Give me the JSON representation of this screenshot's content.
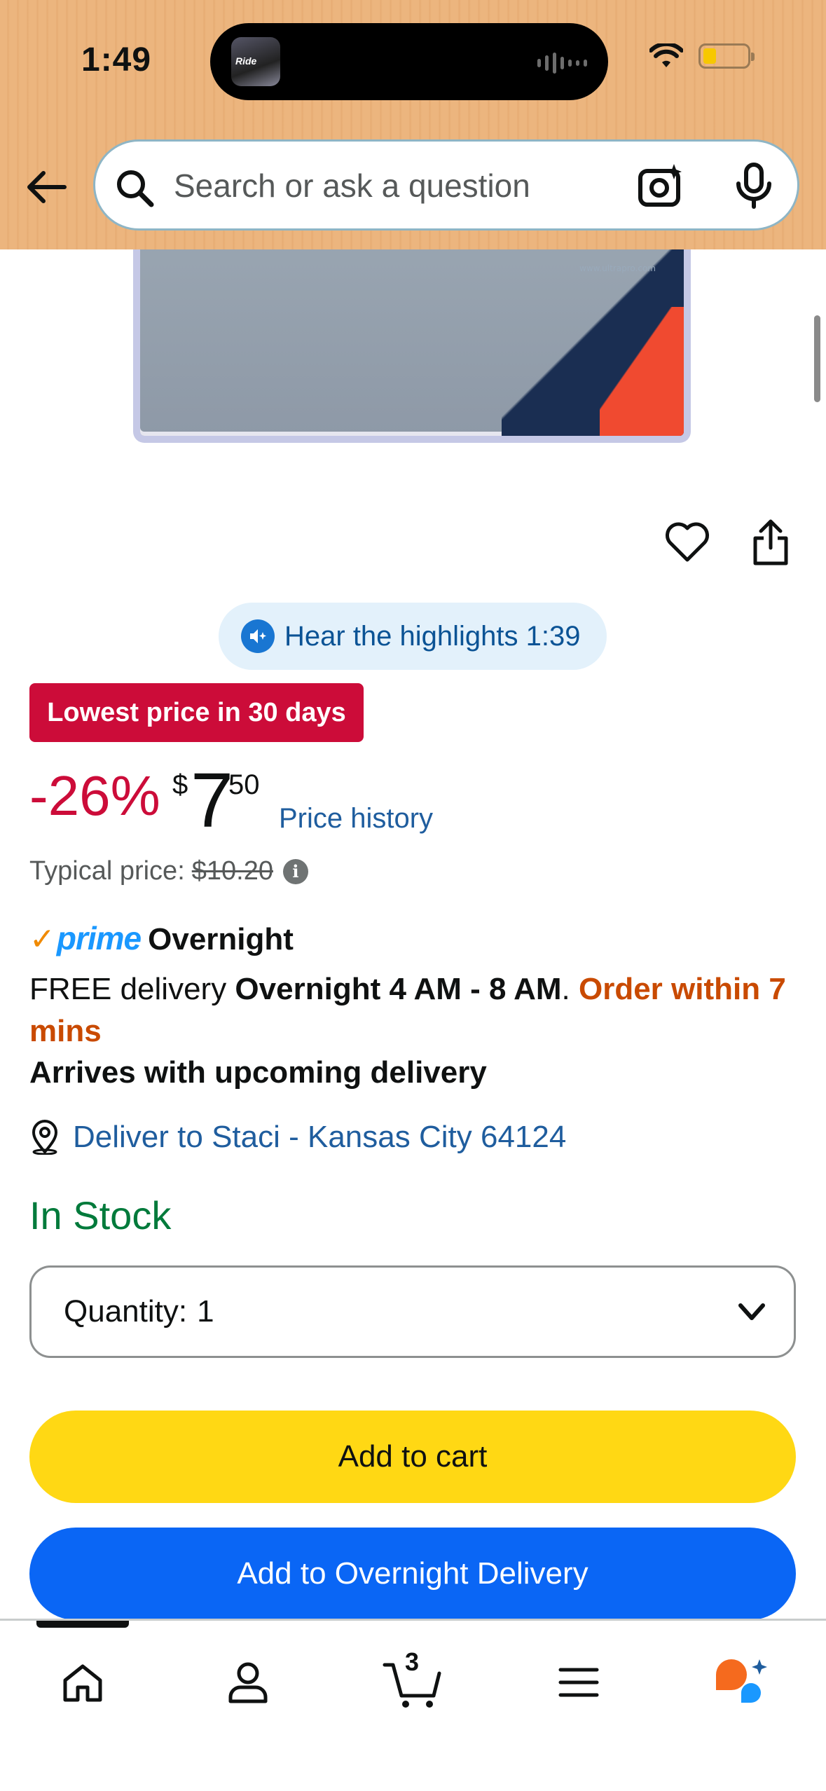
{
  "status_bar": {
    "time": "1:49",
    "island_thumb_text": "Ride"
  },
  "header": {
    "search_placeholder": "Search or ask a question",
    "back_icon": "arrow-left-icon",
    "lens_icon": "camera-lens-icon",
    "mic_icon": "microphone-icon"
  },
  "product_image": {
    "url_text": "www.ultrapro.com"
  },
  "actions": {
    "favorite_icon": "heart-icon",
    "share_icon": "share-icon",
    "hear_label": "Hear the highlights 1:39"
  },
  "price": {
    "deal_badge": "Lowest price in 30 days",
    "discount": "-26%",
    "currency_symbol": "$",
    "whole": "7",
    "fraction": "50",
    "history_link": "Price history",
    "typical_label": "Typical price:",
    "typical_value": "$10.20",
    "info_glyph": "i"
  },
  "delivery": {
    "prime_check": "✓",
    "prime_word": "prime",
    "prime_service": "Overnight",
    "free_prefix": "FREE delivery ",
    "window": "Overnight 4 AM - 8 AM",
    "period": ". ",
    "urgency": "Order within 7 mins",
    "arrives": "Arrives with upcoming delivery",
    "deliver_to": "Deliver to Staci - Kansas City 64124"
  },
  "stock": {
    "status": "In Stock"
  },
  "quantity": {
    "label": "Quantity:",
    "value": "1"
  },
  "buttons": {
    "add_to_cart": "Add to cart",
    "add_overnight": "Add to Overnight Delivery"
  },
  "bottom_nav": {
    "cart_count": "3",
    "items": [
      "home-icon",
      "account-icon",
      "cart-icon",
      "menu-icon",
      "rufus-assistant-icon"
    ]
  },
  "colors": {
    "deal_red": "#cc0c39",
    "link_blue": "#1f5d9e",
    "stock_green": "#007a3b",
    "cart_yellow": "#ffd814",
    "overnight_blue": "#0a66f5",
    "urgent_orange": "#c94a00"
  }
}
